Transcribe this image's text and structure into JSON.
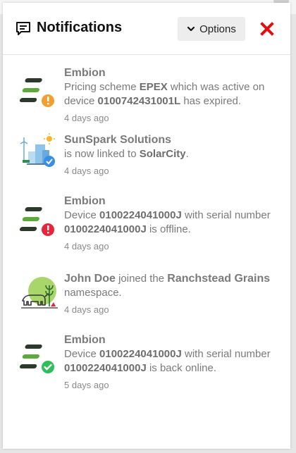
{
  "panel": {
    "title": "Notifications",
    "options_label": "Options",
    "colors": {
      "close": "#e01010",
      "warning": "#f0a030",
      "error": "#e8233a",
      "success": "#2fbf5a",
      "brand_dark": "#2b3a2b",
      "brand_green": "#5fa83c"
    }
  },
  "notifications": [
    {
      "source": "Embion",
      "icon": "embion-logo-warning-icon",
      "parts": [
        "Pricing scheme ",
        "EPEX",
        " which was active on device ",
        "0100742431001L",
        " has expired."
      ],
      "time": "4 days ago"
    },
    {
      "source": "SunSpark Solutions",
      "icon": "solar-city-verified-icon",
      "parts": [
        "is now linked to ",
        "SolarCity",
        "."
      ],
      "time": "4 days ago"
    },
    {
      "source": "Embion",
      "icon": "embion-logo-error-icon",
      "parts": [
        "Device ",
        "0100224041000J",
        " with serial number ",
        "0100224041000J",
        " is offline."
      ],
      "time": "4 days ago"
    },
    {
      "source": "John Doe",
      "icon": "farm-namespace-icon",
      "parts": [
        "joined the ",
        "Ranchstead Grains",
        " namespace."
      ],
      "time": "4 days ago"
    },
    {
      "source": "Embion",
      "icon": "embion-logo-success-icon",
      "parts": [
        "Device ",
        "0100224041000J",
        " with serial number ",
        "0100224041000J",
        " is back online."
      ],
      "time": "5 days ago"
    }
  ]
}
